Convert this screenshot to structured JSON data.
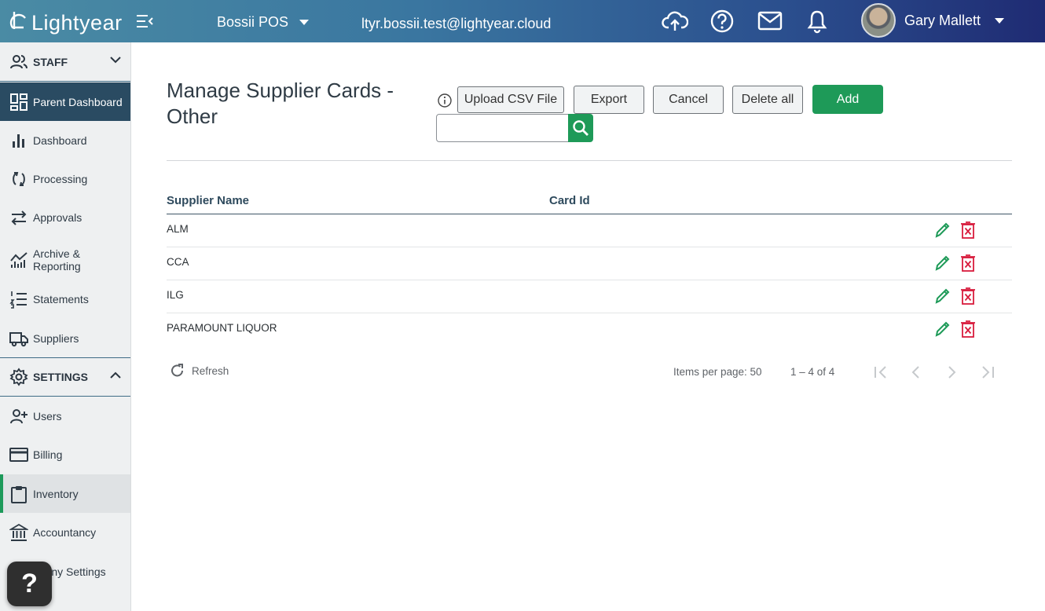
{
  "topbar": {
    "brand": "Lightyear",
    "organisation": "Bossii POS",
    "account_email": "ltyr.bossii.test@lightyear.cloud",
    "user_name": "Gary Mallett",
    "icons": [
      "menu-collapse-icon",
      "cloud-upload-icon",
      "help-icon",
      "mail-icon",
      "bell-icon"
    ]
  },
  "sidebar": {
    "staff_section": "STAFF",
    "items": [
      {
        "label": "Parent Dashboard",
        "icon": "dashboard-grid-icon"
      },
      {
        "label": "Dashboard",
        "icon": "bar-chart-icon"
      },
      {
        "label": "Processing",
        "icon": "processing-icon"
      },
      {
        "label": "Approvals",
        "icon": "swap-arrows-icon"
      },
      {
        "label": "Archive &",
        "label2": "Reporting",
        "icon": "chart-line-icon"
      },
      {
        "label": "Statements",
        "icon": "list-icon"
      },
      {
        "label": "Suppliers",
        "icon": "truck-icon"
      }
    ],
    "settings_section": "SETTINGS",
    "settings_items": [
      {
        "label": "Users",
        "icon": "add-user-icon"
      },
      {
        "label": "Billing",
        "icon": "credit-card-icon"
      },
      {
        "label": "Inventory",
        "icon": "clipboard-icon"
      },
      {
        "label": "Accountancy",
        "icon": "bank-icon"
      },
      {
        "label": "npany Settings",
        "icon": "company-icon"
      }
    ],
    "help_fab": "?"
  },
  "main": {
    "title_line1": "Manage Supplier Cards -",
    "title_line2": "Other",
    "buttons": {
      "upload": "Upload CSV File",
      "export": "Export",
      "cancel": "Cancel",
      "delete_all": "Delete all",
      "add": "Add"
    },
    "search": {
      "value": "",
      "placeholder": ""
    },
    "table": {
      "columns": [
        "Supplier Name",
        "Card Id"
      ],
      "rows": [
        {
          "supplier": "ALM",
          "card_id": ""
        },
        {
          "supplier": "CCA",
          "card_id": ""
        },
        {
          "supplier": "ILG",
          "card_id": ""
        },
        {
          "supplier": "PARAMOUNT LIQUOR",
          "card_id": ""
        }
      ]
    },
    "paginator": {
      "refresh": "Refresh",
      "items_per_page": "Items per page: 50",
      "range": "1 – 4 of 4"
    }
  },
  "colors": {
    "accent_green": "#1e9a58",
    "active_nav": "#2a4b62",
    "delete_red": "#d81b3c"
  }
}
